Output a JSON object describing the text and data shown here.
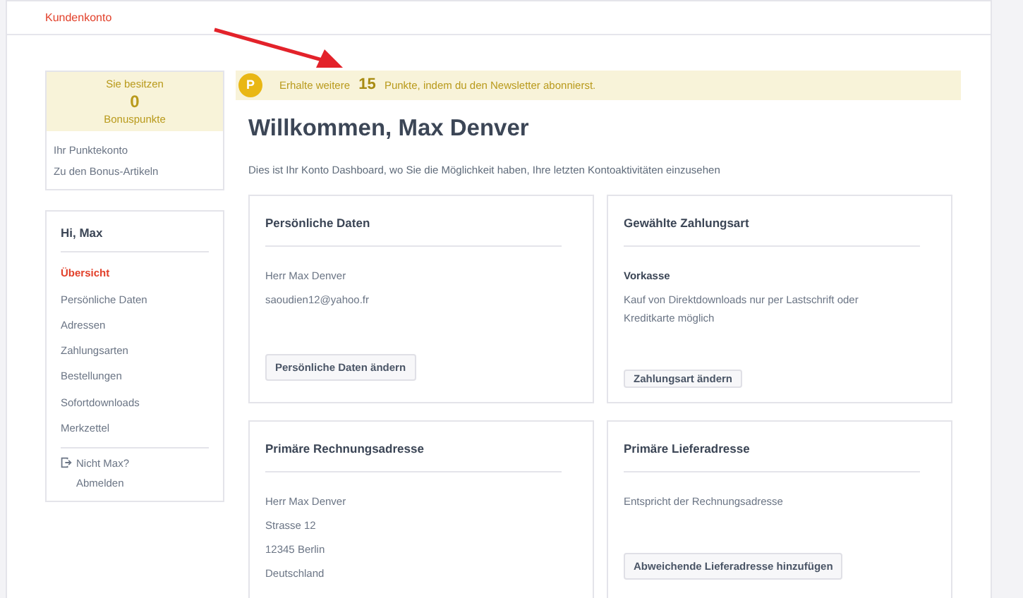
{
  "header": {
    "title": "Kundenkonto"
  },
  "bonus": {
    "label": "Sie besitzen",
    "value": "0",
    "unit": "Bonuspunkte"
  },
  "bonus_links": [
    "Ihr Punktekonto",
    "Zu den Bonus-Artikeln"
  ],
  "menu": {
    "greeting": "Hi, Max",
    "items": [
      {
        "label": "Übersicht",
        "selected": true
      },
      {
        "label": "Persönliche Daten",
        "selected": false
      },
      {
        "label": "Adressen",
        "selected": false
      },
      {
        "label": "Zahlungsarten",
        "selected": false
      },
      {
        "label": "Bestellungen",
        "selected": false
      },
      {
        "label": "Sofortdownloads",
        "selected": false
      },
      {
        "label": "Merkzettel",
        "selected": false
      }
    ],
    "logout": {
      "question": "Nicht Max?",
      "action": "Abmelden"
    }
  },
  "banner": {
    "badge": "P",
    "before": "Erhalte weitere",
    "points": "15",
    "after": "Punkte, indem du den Newsletter abonnierst."
  },
  "title": "Willkommen, Max Denver",
  "intro": "Dies ist Ihr Konto Dashboard, wo Sie die Möglichkeit haben, Ihre letzten Kontoaktivitäten einzusehen",
  "cards": [
    {
      "title": "Persönliche Daten",
      "lines": [
        {
          "kind": "text",
          "text": "Herr Max Denver"
        },
        {
          "kind": "text",
          "text": "saoudien12@yahoo.fr"
        }
      ],
      "button": "Persönliche Daten ändern"
    },
    {
      "title": "Gewählte Zahlungsart",
      "lines": [
        {
          "kind": "heading",
          "text": "Vorkasse"
        },
        {
          "kind": "text",
          "text": "Kauf von Direktdownloads nur per Lastschrift oder Kreditkarte möglich"
        }
      ],
      "button": "Zahlungsart ändern"
    },
    {
      "title": "Primäre Rechnungsadresse",
      "lines": [
        {
          "kind": "text",
          "text": "Herr Max Denver"
        },
        {
          "kind": "text",
          "text": "Strasse 12"
        },
        {
          "kind": "text",
          "text": "12345 Berlin"
        },
        {
          "kind": "text",
          "text": "Deutschland"
        }
      ]
    },
    {
      "title": "Primäre Lieferadresse",
      "lines": [
        {
          "kind": "text",
          "text": "Entspricht der Rechnungsadresse"
        }
      ],
      "button": "Abweichende Lieferadresse hinzufügen"
    }
  ]
}
